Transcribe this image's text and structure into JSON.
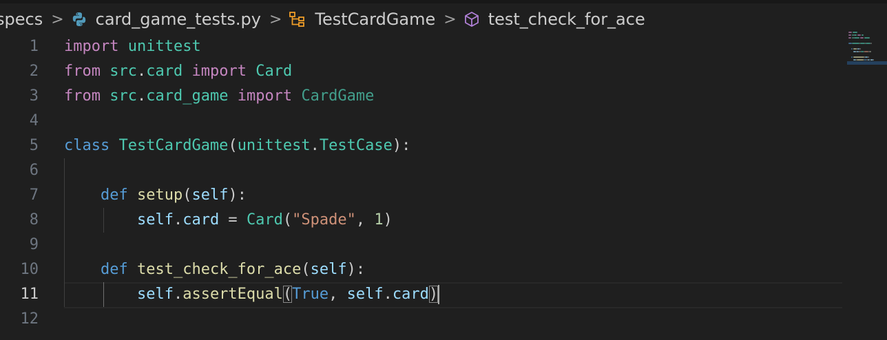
{
  "breadcrumb": {
    "folder": "specs",
    "file": "card_game_tests.py",
    "class": "TestCardGame",
    "method": "test_check_for_ace",
    "separator": ">"
  },
  "icons": {
    "file": "python-icon",
    "class": "symbol-class-icon",
    "method": "symbol-method-icon"
  },
  "editor": {
    "active_line": 11,
    "line_numbers": [
      "1",
      "2",
      "3",
      "4",
      "5",
      "6",
      "7",
      "8",
      "9",
      "10",
      "11",
      "12"
    ],
    "lines": [
      [
        [
          "kw-ctrl",
          "import"
        ],
        [
          "pun",
          " "
        ],
        [
          "mod",
          "unittest"
        ]
      ],
      [
        [
          "kw-ctrl",
          "from"
        ],
        [
          "pun",
          " "
        ],
        [
          "mod",
          "src"
        ],
        [
          "pun",
          "."
        ],
        [
          "mod",
          "card"
        ],
        [
          "pun",
          " "
        ],
        [
          "kw-ctrl",
          "import"
        ],
        [
          "pun",
          " "
        ],
        [
          "mod",
          "Card"
        ]
      ],
      [
        [
          "kw-ctrl",
          "from"
        ],
        [
          "pun",
          " "
        ],
        [
          "mod",
          "src"
        ],
        [
          "pun",
          "."
        ],
        [
          "mod",
          "card_game"
        ],
        [
          "pun",
          " "
        ],
        [
          "kw-ctrl",
          "import"
        ],
        [
          "pun",
          " "
        ],
        [
          "dim",
          "CardGame"
        ]
      ],
      [],
      [
        [
          "kw",
          "class"
        ],
        [
          "pun",
          " "
        ],
        [
          "cls",
          "TestCardGame"
        ],
        [
          "pun",
          "("
        ],
        [
          "mod",
          "unittest"
        ],
        [
          "pun",
          "."
        ],
        [
          "cls",
          "TestCase"
        ],
        [
          "pun",
          "):"
        ]
      ],
      [],
      [
        [
          "pun",
          "    "
        ],
        [
          "kw",
          "def"
        ],
        [
          "pun",
          " "
        ],
        [
          "fn",
          "setup"
        ],
        [
          "pun",
          "("
        ],
        [
          "selfc",
          "self"
        ],
        [
          "pun",
          "):"
        ]
      ],
      [
        [
          "pun",
          "        "
        ],
        [
          "selfc",
          "self"
        ],
        [
          "pun",
          "."
        ],
        [
          "var",
          "card"
        ],
        [
          "pun",
          " = "
        ],
        [
          "cls",
          "Card"
        ],
        [
          "pun",
          "("
        ],
        [
          "str",
          "\"Spade\""
        ],
        [
          "pun",
          ", "
        ],
        [
          "num",
          "1"
        ],
        [
          "pun",
          ")"
        ]
      ],
      [],
      [
        [
          "pun",
          "    "
        ],
        [
          "kw",
          "def"
        ],
        [
          "pun",
          " "
        ],
        [
          "fn",
          "test_check_for_ace"
        ],
        [
          "pun",
          "("
        ],
        [
          "selfc",
          "self"
        ],
        [
          "pun",
          "):"
        ]
      ],
      [
        [
          "pun",
          "        "
        ],
        [
          "selfc",
          "self"
        ],
        [
          "pun",
          "."
        ],
        [
          "fn",
          "assertEqual"
        ],
        [
          "bm",
          "("
        ],
        [
          "kw",
          "True"
        ],
        [
          "pun",
          ", "
        ],
        [
          "selfc",
          "self"
        ],
        [
          "pun",
          "."
        ],
        [
          "var",
          "card"
        ],
        [
          "bm",
          ")"
        ],
        [
          "cursor",
          ""
        ]
      ],
      []
    ]
  },
  "colors": {
    "background": "#1f1f1f",
    "keyword_control": "#c586c0",
    "keyword": "#569cd6",
    "type": "#4ec9b0",
    "function": "#dcdcaa",
    "variable": "#9cdcfe",
    "string": "#ce9178",
    "number": "#b5cea8",
    "line_number": "#6e7681",
    "line_number_active": "#cccccc"
  }
}
